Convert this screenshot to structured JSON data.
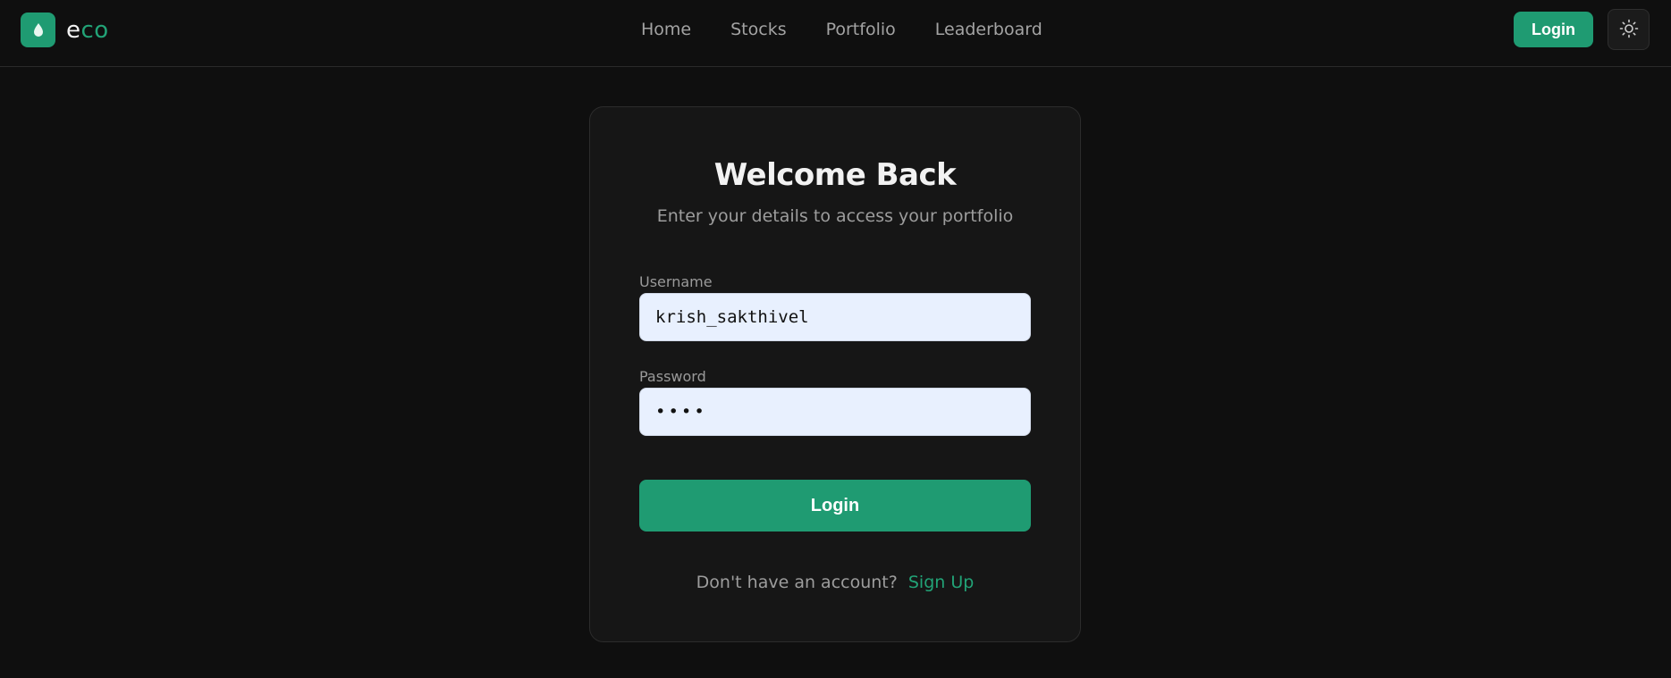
{
  "brand": {
    "name_part1": "e",
    "name_part2": "co",
    "logo_icon": "leaf-drop-icon",
    "accent_color": "#1f9b72"
  },
  "nav": {
    "links": [
      "Home",
      "Stocks",
      "Portfolio",
      "Leaderboard"
    ],
    "login_label": "Login",
    "theme_icon": "sun-icon"
  },
  "login_card": {
    "title": "Welcome Back",
    "subtitle": "Enter your details to access your portfolio",
    "username_label": "Username",
    "username_value": "krish_sakthivel",
    "password_label": "Password",
    "password_value": "••••",
    "submit_label": "Login",
    "signup_prompt": "Don't have an account?",
    "signup_link": "Sign Up"
  }
}
